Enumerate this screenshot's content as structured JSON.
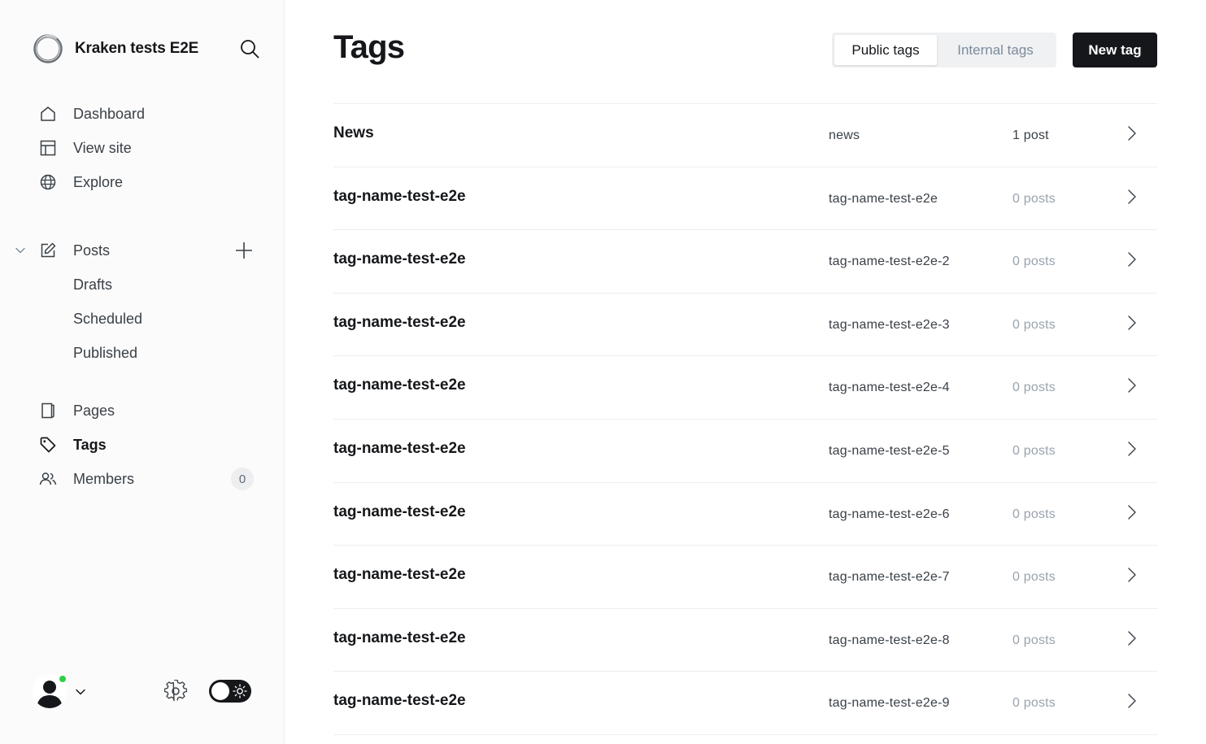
{
  "sidebar": {
    "site_title": "Kraken tests E2E",
    "nav_primary": [
      {
        "label": "Dashboard",
        "icon": "home-icon"
      },
      {
        "label": "View site",
        "icon": "layout-icon"
      },
      {
        "label": "Explore",
        "icon": "globe-icon"
      }
    ],
    "posts": {
      "label": "Posts",
      "subitems": [
        "Drafts",
        "Scheduled",
        "Published"
      ]
    },
    "nav_secondary": [
      {
        "label": "Pages",
        "icon": "page-icon"
      },
      {
        "label": "Tags",
        "icon": "tag-icon",
        "active": true
      },
      {
        "label": "Members",
        "icon": "members-icon",
        "count": "0"
      }
    ],
    "online_status_color": "#30cf43"
  },
  "main": {
    "title": "Tags",
    "tabs": {
      "public": "Public tags",
      "internal": "Internal tags",
      "selected": "public"
    },
    "new_tag_label": "New tag",
    "tags": [
      {
        "name": "News",
        "slug": "news",
        "count": "1 post"
      },
      {
        "name": "tag-name-test-e2e",
        "slug": "tag-name-test-e2e",
        "count": "0 posts"
      },
      {
        "name": "tag-name-test-e2e",
        "slug": "tag-name-test-e2e-2",
        "count": "0 posts"
      },
      {
        "name": "tag-name-test-e2e",
        "slug": "tag-name-test-e2e-3",
        "count": "0 posts"
      },
      {
        "name": "tag-name-test-e2e",
        "slug": "tag-name-test-e2e-4",
        "count": "0 posts"
      },
      {
        "name": "tag-name-test-e2e",
        "slug": "tag-name-test-e2e-5",
        "count": "0 posts"
      },
      {
        "name": "tag-name-test-e2e",
        "slug": "tag-name-test-e2e-6",
        "count": "0 posts"
      },
      {
        "name": "tag-name-test-e2e",
        "slug": "tag-name-test-e2e-7",
        "count": "0 posts"
      },
      {
        "name": "tag-name-test-e2e",
        "slug": "tag-name-test-e2e-8",
        "count": "0 posts"
      },
      {
        "name": "tag-name-test-e2e",
        "slug": "tag-name-test-e2e-9",
        "count": "0 posts"
      }
    ]
  }
}
